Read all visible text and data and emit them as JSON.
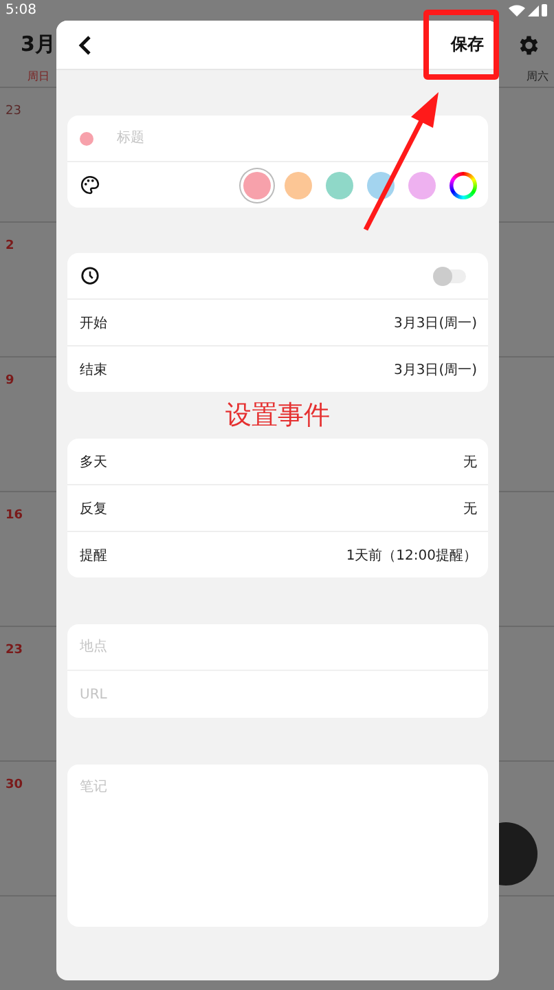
{
  "status_bar": {
    "time": "5:08"
  },
  "calendar": {
    "month": "3月",
    "weekdays": [
      {
        "label": "周日"
      },
      {
        "label": "周六"
      }
    ],
    "weeks": [
      {
        "date": "23",
        "muted": true
      },
      {
        "date": "2",
        "muted": false
      },
      {
        "date": "9",
        "muted": false
      },
      {
        "date": "16",
        "muted": false
      },
      {
        "date": "23",
        "muted": false
      },
      {
        "date": "30",
        "muted": false
      }
    ]
  },
  "dialog": {
    "save_button": "保存",
    "title_field": {
      "placeholder": "标题",
      "color": "#f7a1ab"
    },
    "swatches": [
      {
        "kind": "color",
        "color": "#f7a1ab",
        "selected": true
      },
      {
        "kind": "color",
        "color": "#fcc695",
        "selected": false
      },
      {
        "kind": "color",
        "color": "#8fd8c8",
        "selected": false
      },
      {
        "kind": "color",
        "color": "#a3d4ef",
        "selected": false
      },
      {
        "kind": "color",
        "color": "#eeb1f0",
        "selected": false
      },
      {
        "kind": "custom",
        "selected": false
      }
    ],
    "all_day_toggle": {
      "on": false
    },
    "date_rows": [
      {
        "label": "开始",
        "value": "3月3日(周一)"
      },
      {
        "label": "结束",
        "value": "3月3日(周一)"
      }
    ],
    "options": [
      {
        "label": "多天",
        "value": "无"
      },
      {
        "label": "反复",
        "value": "无"
      },
      {
        "label": "提醒",
        "value": "1天前（12:00提醒）"
      }
    ],
    "location": {
      "placeholder": "地点"
    },
    "url": {
      "placeholder": "URL"
    },
    "notes": {
      "placeholder": "笔记"
    }
  },
  "annotation": {
    "text": "设置事件"
  }
}
